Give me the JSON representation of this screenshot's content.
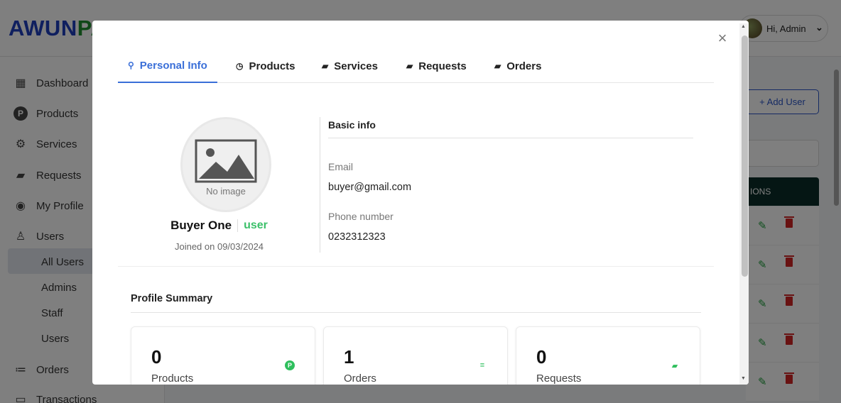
{
  "app": {
    "logo_part1": "AWUN",
    "logo_part2": "PA",
    "user_greeting": "Hi, Admin"
  },
  "sidebar": {
    "items": [
      {
        "label": "Dashboard",
        "icon": "dashboard-icon"
      },
      {
        "label": "Products",
        "icon": "products-icon"
      },
      {
        "label": "Services",
        "icon": "services-icon"
      },
      {
        "label": "Requests",
        "icon": "requests-icon"
      },
      {
        "label": "My Profile",
        "icon": "profile-icon"
      },
      {
        "label": "Users",
        "icon": "users-icon"
      }
    ],
    "sub_items": [
      "All Users",
      "Admins",
      "Staff",
      "Users"
    ],
    "orders_label": "Orders",
    "transactions_label": "Transactions"
  },
  "background": {
    "add_user_label": "+ Add User",
    "actions_header": "IONS"
  },
  "modal": {
    "close_glyph": "×",
    "tabs": [
      {
        "label": "Personal Info",
        "icon": "user-edit-icon",
        "active": true
      },
      {
        "label": "Products",
        "icon": "clock-icon",
        "active": false
      },
      {
        "label": "Services",
        "icon": "message-icon",
        "active": false
      },
      {
        "label": "Requests",
        "icon": "message-icon",
        "active": false
      },
      {
        "label": "Orders",
        "icon": "message-icon",
        "active": false
      }
    ],
    "profile": {
      "no_image": "No image",
      "name": "Buyer One",
      "role": "user",
      "joined": "Joined on 09/03/2024"
    },
    "basic_info": {
      "title": "Basic info",
      "email_label": "Email",
      "email": "buyer@gmail.com",
      "phone_label": "Phone number",
      "phone": "0232312323"
    },
    "summary": {
      "title": "Profile Summary",
      "cards": [
        {
          "value": "0",
          "label": "Products",
          "icon": "product-badge-icon"
        },
        {
          "value": "1",
          "label": "Orders",
          "icon": "list-icon"
        },
        {
          "value": "0",
          "label": "Requests",
          "icon": "chat-icon"
        }
      ]
    }
  },
  "colors": {
    "accent": "#3a6fd8",
    "role_green": "#3cc06a",
    "logo_blue": "#1f3fbf",
    "logo_green": "#1e8e2e",
    "table_header": "#0b2d28",
    "delete_red": "#d32525"
  }
}
